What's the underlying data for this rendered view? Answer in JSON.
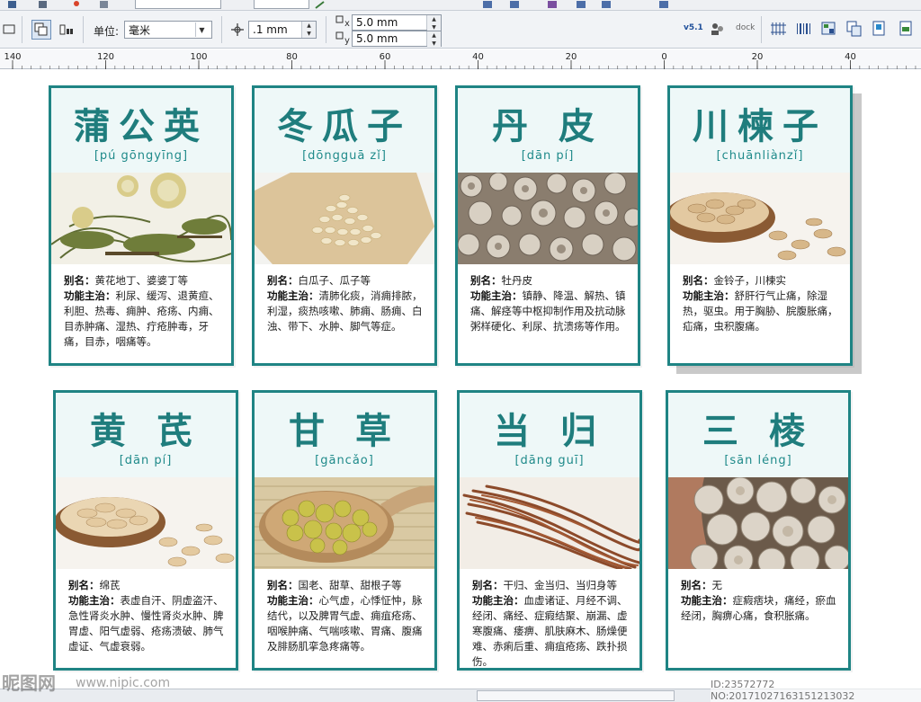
{
  "propbar": {
    "unit_label": "单位:",
    "unit_value": "毫米",
    "nudge_value": ".1 mm",
    "dup_x": "5.0 mm",
    "dup_y": "5.0 mm",
    "x_label": "x",
    "y_label": "y",
    "right_icons": [
      "v5.1",
      "dock"
    ]
  },
  "ruler": {
    "labels": [
      "140",
      "120",
      "100",
      "80",
      "60",
      "40",
      "20",
      "0",
      "20",
      "40"
    ]
  },
  "cards": [
    {
      "name_cn": "蒲公英",
      "pinyin": "[pú gōngyīng]",
      "alias_label": "别名：",
      "alias": "黄花地丁、婆婆丁等",
      "func_label": "功能主治：",
      "func": "利尿、缓泻、退黄疸、利胆、热毒、痈肿、疮疡、内痈、目赤肿痛、湿热、疔疮肿毒，牙痛，目赤，咽痛等。"
    },
    {
      "name_cn": "冬瓜子",
      "pinyin": "[dōngguā zǐ]",
      "alias_label": "别名：",
      "alias": "白瓜子、瓜子等",
      "func_label": "功能主治：",
      "func": "清肺化痰，消痈排脓，利湿，痰热咳嗽、肺痈、肠痈、白浊、带下、水肿、脚气等症。"
    },
    {
      "name_cn": "丹 皮",
      "pinyin": "[dān pí]",
      "alias_label": "别名：",
      "alias": "牡丹皮",
      "func_label": "功能主治：",
      "func": "镇静、降温、解热、镇痛、解痉等中枢抑制作用及抗动脉粥样硬化、利尿、抗溃疡等作用。"
    },
    {
      "name_cn": "川楝子",
      "pinyin": "[chuānliànzǐ]",
      "alias_label": "别名：",
      "alias": "金铃子，川楝实",
      "func_label": "功能主治：",
      "func": "舒肝行气止痛，除湿热，驱虫。用于胸胁、脘腹胀痛，疝痛，虫积腹痛。"
    },
    {
      "name_cn": "黄 芪",
      "pinyin": "[dān pí]",
      "alias_label": "别名：",
      "alias": "绵芪",
      "func_label": "功能主治：",
      "func": "表虚自汗、阴虚盗汗、急性肾炎水肿、慢性肾炎水肿、脾胃虚、阳气虚弱、疮疡溃破、肺气虚证、气虚衰弱。"
    },
    {
      "name_cn": "甘 草",
      "pinyin": "[gāncǎo]",
      "alias_label": "别名：",
      "alias": "国老、甜草、甜根子等",
      "func_label": "功能主治：",
      "func": "心气虚，心悸怔忡，脉结代，以及脾胃气虚、痈疽疮疡、咽喉肿痛、气喘咳嗽、胃痛、腹痛及腓肠肌挛急疼痛等。"
    },
    {
      "name_cn": "当 归",
      "pinyin": "[dāng guī]",
      "alias_label": "别名：",
      "alias": "干归、金当归、当归身等",
      "func_label": "功能主治：",
      "func": "血虚诸证、月经不调、经闭、痛经、症瘕结聚、崩漏、虚寒腹痛、痿痹、肌肤麻木、肠燥便难、赤痢后重、痈疽疮疡、跌扑损伤。"
    },
    {
      "name_cn": "三 棱",
      "pinyin": "[sān léng]",
      "alias_label": "别名：",
      "alias": "无",
      "func_label": "功能主治：",
      "func": "症瘕痞块，痛经，瘀血经闭，胸痹心痛，食积胀痛。"
    }
  ],
  "watermark": {
    "logo": "昵图网",
    "url": "www.nipic.com",
    "id": "ID:23572772 NO:20171027163151213032"
  },
  "colors": {
    "teal": "#1f8484",
    "title_teal": "#1f7d7d",
    "head_bg": "#eef8f8"
  }
}
